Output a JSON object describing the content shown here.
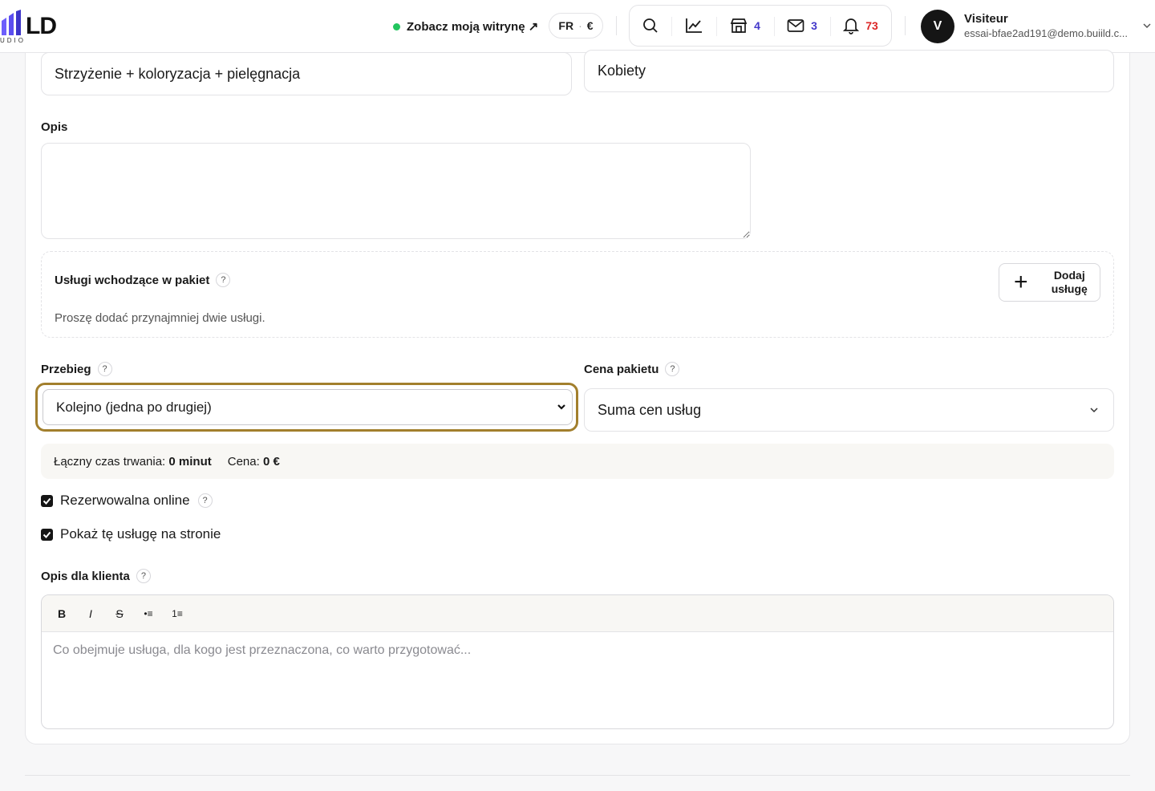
{
  "header": {
    "logo_text": "LD",
    "logo_sub": "UDIO",
    "site_link": "Zobacz moją witrynę ↗",
    "lang": "FR",
    "currency": "€",
    "icons": [
      {
        "name": "search-icon",
        "count": ""
      },
      {
        "name": "stats-icon",
        "count": ""
      },
      {
        "name": "store-icon",
        "count": "4"
      },
      {
        "name": "mail-icon",
        "count": "3"
      },
      {
        "name": "bell-icon",
        "count": "73"
      }
    ],
    "user": {
      "initial": "V",
      "name": "Visiteur",
      "email": "essai-bfae2ad191@demo.buiild.c..."
    }
  },
  "form": {
    "name_value": "Strzyżenie + koloryzacja + pielęgnacja",
    "category_value": "Kobiety",
    "description_label": "Opis",
    "description_value": "",
    "package": {
      "title": "Usługi wchodzące w pakiet",
      "note": "Proszę dodać przynajmniej dwie usługi.",
      "add_button": "Dodaj usługę"
    },
    "flow": {
      "label": "Przebieg",
      "value": "Kolejno (jedna po drugiej)"
    },
    "price": {
      "label": "Cena pakietu",
      "value": "Suma cen usług"
    },
    "summary": {
      "duration_label": "Łączny czas trwania:",
      "duration_value": "0 minut",
      "price_label": "Cena:",
      "price_value": "0 €"
    },
    "checkboxes": [
      {
        "label": "Rezerwowalna online",
        "checked": true
      },
      {
        "label": "Pokaż tę usługę na stronie",
        "checked": true
      }
    ],
    "client_desc": {
      "label": "Opis dla klienta",
      "toolbar": [
        "B",
        "I",
        "S",
        "•≡",
        "1≡"
      ],
      "placeholder": "Co obejmuje usługa, dla kogo jest przeznaczona, co warto przygotować..."
    }
  },
  "colors": {
    "accent_focus": "#a27f2d",
    "online_dot": "#22c55e",
    "badge_blue": "#4338ca",
    "badge_red": "#dc2626"
  }
}
